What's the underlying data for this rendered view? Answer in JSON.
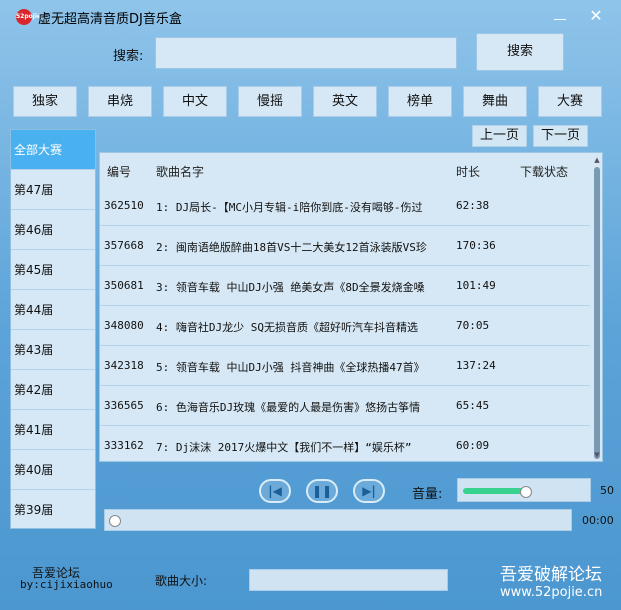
{
  "window": {
    "title": "虚无超高清音质DJ音乐盒",
    "icon_text": "52pojie",
    "close_glyph": "✕"
  },
  "search": {
    "label": "搜索:",
    "value": "",
    "button_label": "搜索"
  },
  "categories": [
    "独家",
    "串烧",
    "中文",
    "慢摇",
    "英文",
    "榜单",
    "舞曲",
    "大赛"
  ],
  "pagination": {
    "prev_label": "上一页",
    "next_label": "下一页"
  },
  "sidebar": {
    "selected_index": 0,
    "items": [
      "全部大赛",
      "第47届",
      "第46届",
      "第45届",
      "第44届",
      "第43届",
      "第42届",
      "第41届",
      "第40届",
      "第39届"
    ]
  },
  "table": {
    "headers": {
      "id": "编号",
      "name": "歌曲名字",
      "duration": "时长",
      "download": "下载状态"
    },
    "rows": [
      {
        "id": "362510",
        "name": "1: DJ局长-【MC小月专辑-i陪你到底-没有喝够-伤过",
        "duration": "62:38",
        "download": ""
      },
      {
        "id": "357668",
        "name": "2: 闽南语绝版醉曲18首VS十二大美女12首泳装版VS珍",
        "duration": "170:36",
        "download": ""
      },
      {
        "id": "350681",
        "name": "3: 领音车载 中山DJ小强 绝美女声《8D全景发烧金嗓",
        "duration": "101:49",
        "download": ""
      },
      {
        "id": "348080",
        "name": "4: 嗨音社DJ龙少 SQ无损音质《超好听汽车抖音精选",
        "duration": "70:05",
        "download": ""
      },
      {
        "id": "342318",
        "name": "5: 领音车载 中山DJ小强 抖音神曲《全球热播47首》",
        "duration": "137:24",
        "download": ""
      },
      {
        "id": "336565",
        "name": "6: 色海音乐DJ玫瑰《最爱的人最是伤害》悠扬古筝情",
        "duration": "65:45",
        "download": ""
      },
      {
        "id": "333162",
        "name": "7: Dj沫沫 2017火爆中文【我们不一样】“娱乐杯”",
        "duration": "60:09",
        "download": ""
      }
    ]
  },
  "player": {
    "prev_icon": "skip-back-icon",
    "pause_icon": "pause-icon",
    "next_icon": "skip-forward-icon",
    "volume_label": "音量:",
    "volume_value": "50",
    "volume_fraction": 0.5,
    "progress_fraction": 0,
    "time": "00:00"
  },
  "footer": {
    "forum_name": "吾爱论坛",
    "author": "by:cijixiaohuo",
    "size_label": "歌曲大小:",
    "size_value": ""
  },
  "watermark": {
    "line1": "吾爱破解论坛",
    "line2": "www.52pojie.cn"
  },
  "colors": {
    "selected": "#4ab1f0",
    "volume_fill": "#36d28e",
    "background_top": "#8fc4ea",
    "background_bottom": "#4c97d0"
  }
}
